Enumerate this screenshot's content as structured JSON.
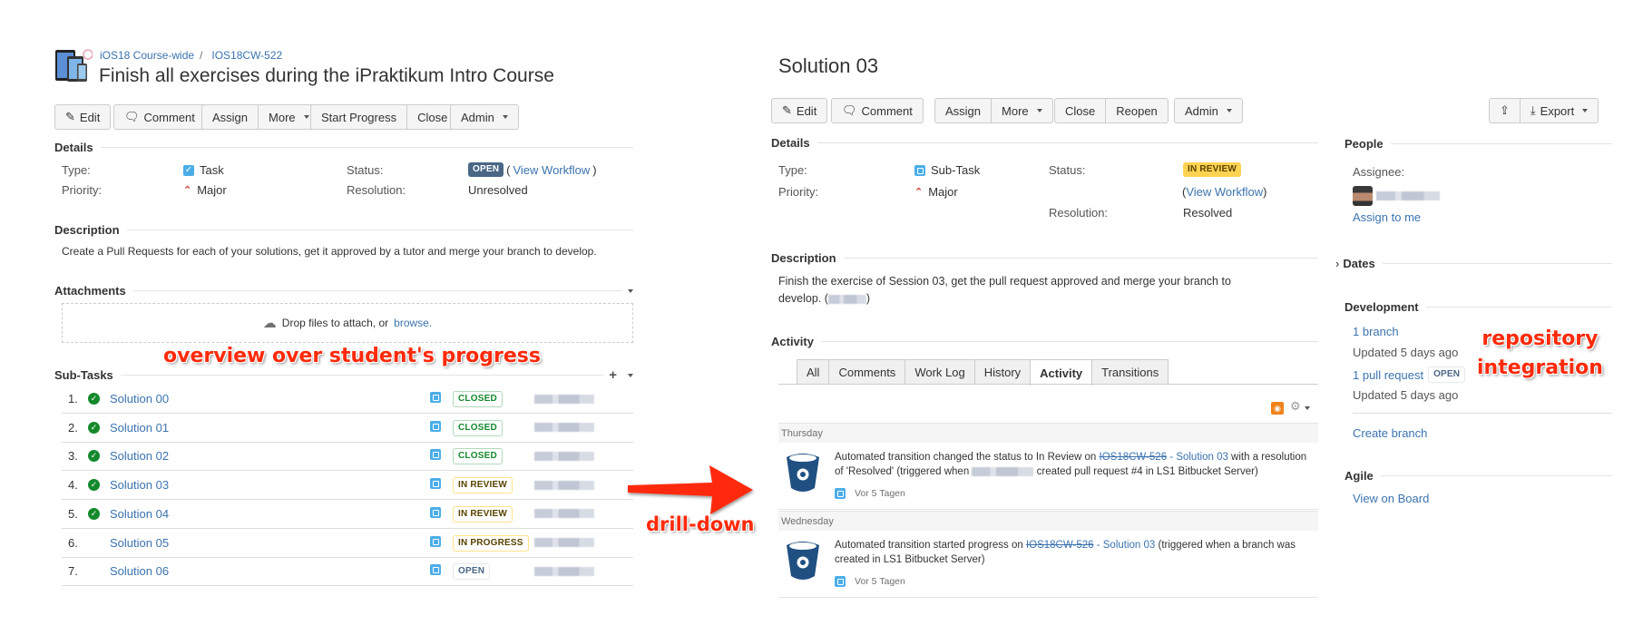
{
  "left": {
    "breadcrumb": {
      "project": "iOS18 Course-wide",
      "separator": "/",
      "issue_key": "IOS18CW-522"
    },
    "title": "Finish all exercises during the iPraktikum Intro Course",
    "toolbar": {
      "edit": "Edit",
      "comment": "Comment",
      "assign": "Assign",
      "more": "More",
      "start_progress": "Start Progress",
      "close": "Close",
      "admin": "Admin"
    },
    "details": {
      "heading": "Details",
      "type_label": "Type:",
      "type_value": "Task",
      "priority_label": "Priority:",
      "priority_value": "Major",
      "status_label": "Status:",
      "status_value": "OPEN",
      "view_workflow": "View Workflow",
      "resolution_label": "Resolution:",
      "resolution_value": "Unresolved"
    },
    "description": {
      "heading": "Description",
      "text": "Create a Pull Requests for each of your solutions, get it approved by a tutor and merge your branch to develop."
    },
    "attachments": {
      "heading": "Attachments",
      "drop_text": "Drop files to attach, or",
      "browse": "browse."
    },
    "subtasks": {
      "heading": "Sub-Tasks",
      "items": [
        {
          "num": "1.",
          "done": true,
          "name": "Solution 00",
          "status": "CLOSED"
        },
        {
          "num": "2.",
          "done": true,
          "name": "Solution 01",
          "status": "CLOSED"
        },
        {
          "num": "3.",
          "done": true,
          "name": "Solution 02",
          "status": "CLOSED"
        },
        {
          "num": "4.",
          "done": true,
          "name": "Solution 03",
          "status": "IN REVIEW"
        },
        {
          "num": "5.",
          "done": true,
          "name": "Solution 04",
          "status": "IN REVIEW"
        },
        {
          "num": "6.",
          "done": false,
          "name": "Solution 05",
          "status": "IN PROGRESS"
        },
        {
          "num": "7.",
          "done": false,
          "name": "Solution 06",
          "status": "OPEN"
        }
      ]
    }
  },
  "right": {
    "title": "Solution 03",
    "toolbar": {
      "edit": "Edit",
      "comment": "Comment",
      "assign": "Assign",
      "more": "More",
      "close": "Close",
      "reopen": "Reopen",
      "admin": "Admin",
      "export": "Export"
    },
    "details": {
      "heading": "Details",
      "type_label": "Type:",
      "type_value": "Sub-Task",
      "priority_label": "Priority:",
      "priority_value": "Major",
      "status_label": "Status:",
      "status_value": "IN REVIEW",
      "view_workflow": "View Workflow",
      "resolution_label": "Resolution:",
      "resolution_value": "Resolved"
    },
    "description": {
      "heading": "Description",
      "text_line1": "Finish the exercise of Session 03, get the pull request approved and merge your branch to",
      "text_line2_prefix": "develop. (",
      "text_line2_suffix": ")"
    },
    "activity": {
      "heading": "Activity",
      "tabs": [
        "All",
        "Comments",
        "Work Log",
        "History",
        "Activity",
        "Transitions"
      ],
      "active_tab": "Activity",
      "groups": [
        {
          "day": "Thursday",
          "text_pre": "Automated transition changed the status to In Review on ",
          "issue_key": "IOS18CW-526",
          "issue_title": " - Solution 03",
          "text_post_line1": " with a resolution",
          "text_line2_pre": "of 'Resolved' (triggered when ",
          "text_line2_post": " created pull request #4 in LS1 Bitbucket Server)",
          "time": "Vor 5 Tagen"
        },
        {
          "day": "Wednesday",
          "text_pre": "Automated transition started progress on ",
          "issue_key": "IOS18CW-526",
          "issue_title": " - Solution 03",
          "text_post_line1": " (triggered when a branch was",
          "text_line2_pre": "created in LS1 Bitbucket Server)",
          "text_line2_post": "",
          "time": "Vor 5 Tagen"
        }
      ]
    },
    "people": {
      "heading": "People",
      "assignee_label": "Assignee:",
      "assign_to_me": "Assign to me"
    },
    "dates": {
      "heading": "Dates"
    },
    "development": {
      "heading": "Development",
      "branch": "1 branch",
      "branch_updated": "Updated 5 days ago",
      "pull_request": "1 pull request",
      "pr_status": "OPEN",
      "pr_updated": "Updated 5 days ago",
      "create_branch": "Create branch"
    },
    "agile": {
      "heading": "Agile",
      "view_on_board": "View on Board"
    }
  },
  "annotations": {
    "overview": "overview over student's progress",
    "drilldown": "drill-down",
    "repo_line1": "repository",
    "repo_line2": "integration"
  },
  "colors": {
    "link": "#3b73af",
    "annotation": "#ff2a0a",
    "success": "#14892c",
    "bitbucket": "#205081"
  }
}
